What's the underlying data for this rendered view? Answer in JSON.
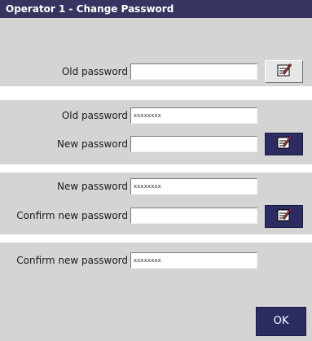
{
  "title": "Operator 1 - Change Password",
  "step1": {
    "old_password_label": "Old password",
    "old_password_value": "",
    "edit_icon": "edit-note-icon"
  },
  "step2": {
    "old_password_label": "Old password",
    "old_password_value": "xxxxxxxx",
    "new_password_label": "New password",
    "new_password_value": "",
    "edit_icon": "edit-note-icon"
  },
  "step3": {
    "new_password_label": "New password",
    "new_password_value": "xxxxxxxx",
    "confirm_label": "Confirm new password",
    "confirm_value": "",
    "edit_icon": "edit-note-icon"
  },
  "step4": {
    "confirm_label": "Confirm new password",
    "confirm_value": "xxxxxxxx",
    "ok_label": "OK"
  },
  "colors": {
    "titlebar": "#36355f",
    "panel": "#d4d4d4",
    "active_button": "#2c2c63"
  }
}
